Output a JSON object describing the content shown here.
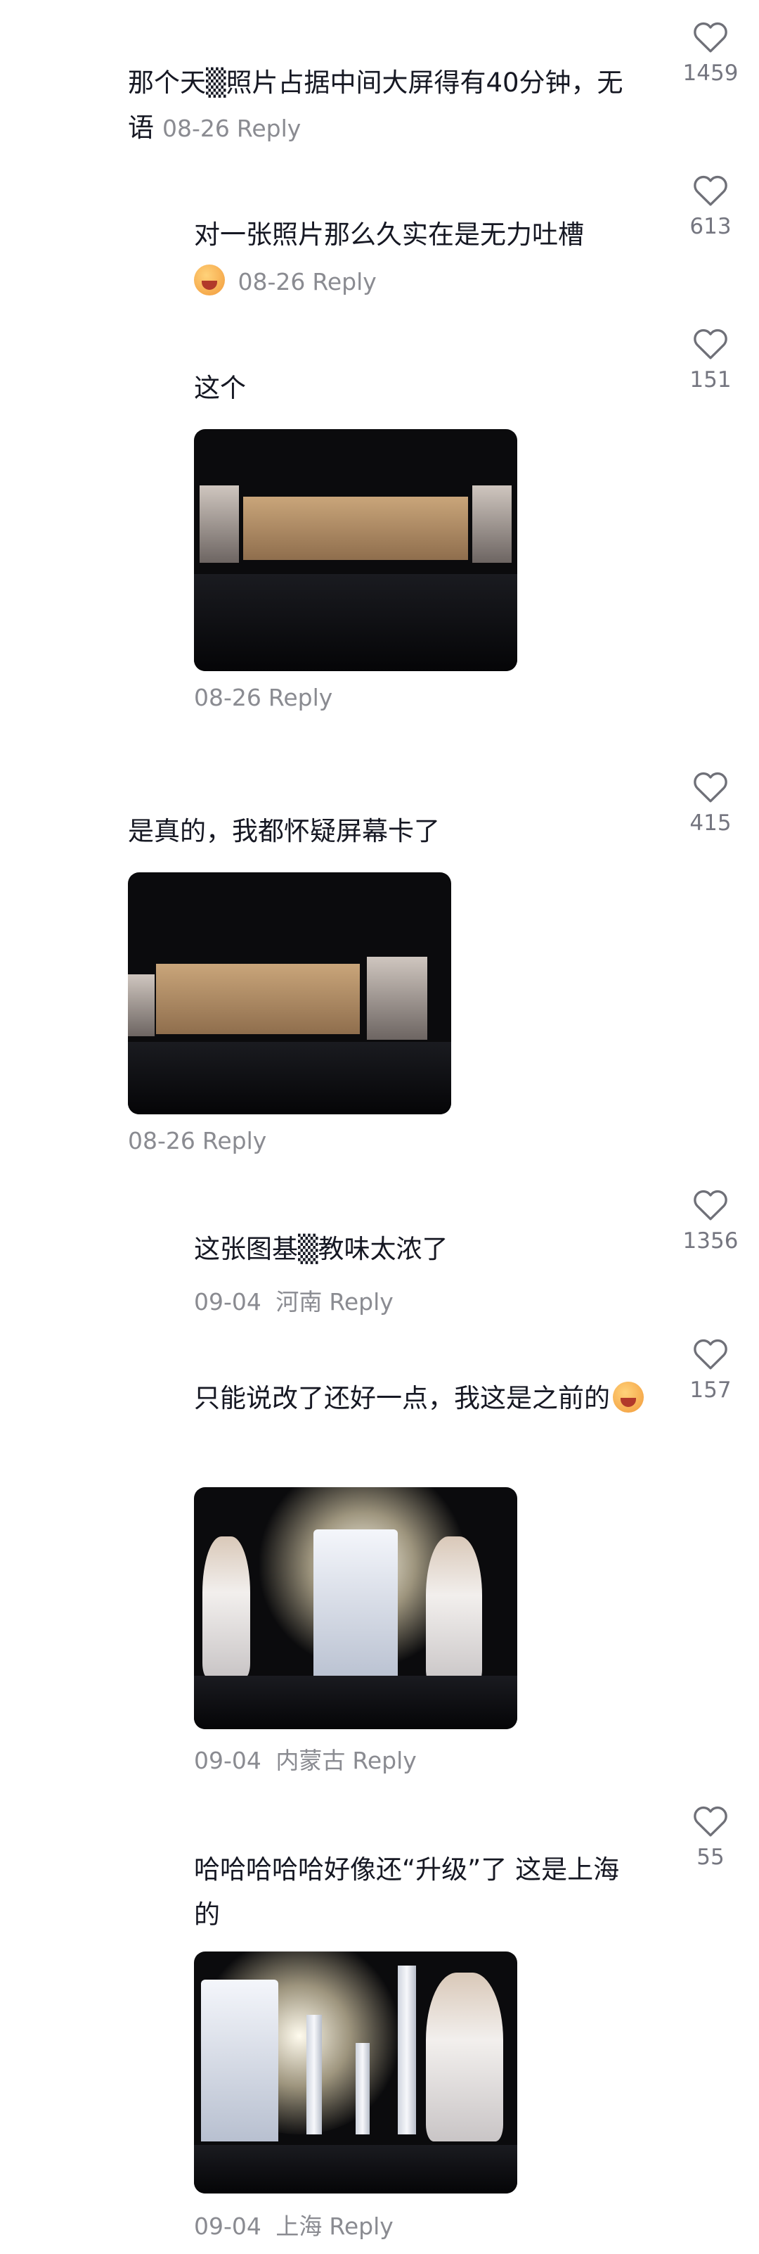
{
  "comments": [
    {
      "text": "那个天▒照片占据中间大屏得有40分钟，无语",
      "date": "08-26",
      "location": "",
      "reply": "Reply",
      "likes": "1459"
    },
    {
      "text": "对一张照片那么久实在是无力吐槽",
      "date": "08-26",
      "location": "",
      "reply": "Reply",
      "likes": "613",
      "emoji": "crying-face"
    },
    {
      "text": "这个",
      "date": "08-26",
      "location": "",
      "reply": "Reply",
      "likes": "151",
      "image": "concert-screen-photo"
    },
    {
      "text": "是真的，我都怀疑屏幕卡了",
      "date": "08-26",
      "location": "",
      "reply": "Reply",
      "likes": "415",
      "image": "concert-screen-photo"
    },
    {
      "text": "这张图基▒教味太浓了",
      "date": "09-04",
      "location": "河南",
      "reply": "Reply",
      "likes": "1356"
    },
    {
      "text": "只能说改了还好一点，我这是之前的",
      "date": "09-04",
      "location": "内蒙古",
      "reply": "Reply",
      "likes": "157",
      "emoji": "crying-face",
      "image": "concert-throne-photo"
    },
    {
      "text": "哈哈哈哈哈好像还“升级”了 这是上海的",
      "date": "09-04",
      "location": "上海",
      "reply": "Reply",
      "likes": "55",
      "image": "concert-throne-photo"
    }
  ]
}
